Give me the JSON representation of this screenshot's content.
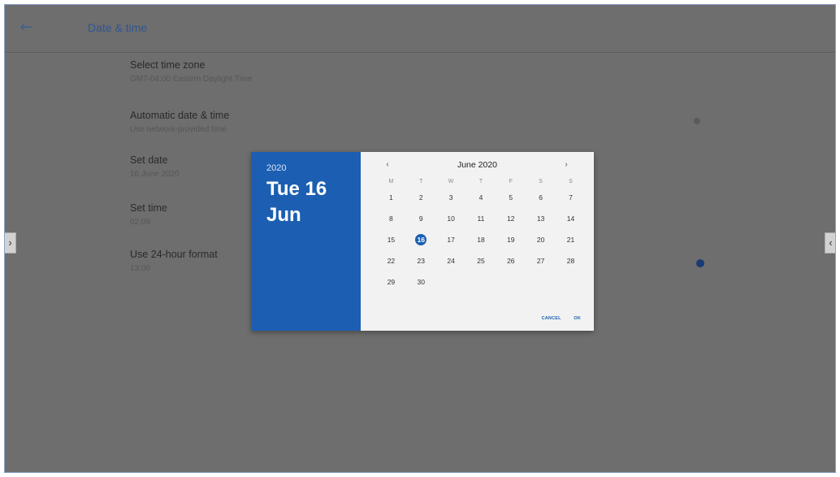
{
  "topbar": {
    "back_icon": "arrow-left-icon",
    "title": "Date & time"
  },
  "settings": [
    {
      "id": "timezone",
      "label": "Select time zone",
      "sub": "GMT-04:00 Eastern Daylight Time"
    },
    {
      "id": "auto",
      "label": "Automatic date & time",
      "sub": "Use network-provided time"
    },
    {
      "id": "date",
      "label": "Set date",
      "sub": "16 June 2020"
    },
    {
      "id": "time",
      "label": "Set time",
      "sub": "02:09"
    },
    {
      "id": "format",
      "label": "Use 24-hour format",
      "sub": "13:00"
    }
  ],
  "side_buttons": {
    "left": "›",
    "right": "‹"
  },
  "dialog": {
    "year": "2020",
    "date_line1": "Tue 16",
    "date_line2": "Jun",
    "month_label": "June 2020",
    "prev": "‹",
    "next": "›",
    "weekdays": [
      "M",
      "T",
      "W",
      "T",
      "F",
      "S",
      "S"
    ],
    "days": [
      "1",
      "2",
      "3",
      "4",
      "5",
      "6",
      "7",
      "8",
      "9",
      "10",
      "11",
      "12",
      "13",
      "14",
      "15",
      "16",
      "17",
      "18",
      "19",
      "20",
      "21",
      "22",
      "23",
      "24",
      "25",
      "26",
      "27",
      "28",
      "29",
      "30"
    ],
    "selected_day": "16",
    "cancel": "CANCEL",
    "ok": "OK",
    "accent_color": "#1c5fb2"
  }
}
